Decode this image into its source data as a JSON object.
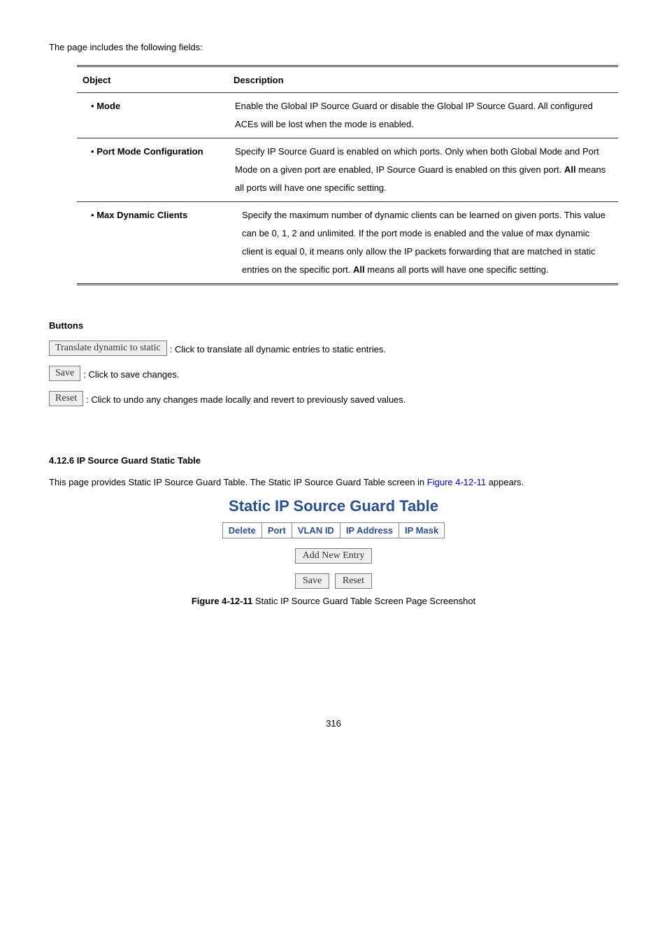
{
  "intro": "The page includes the following fields:",
  "table": {
    "headers": [
      "Object",
      "Description"
    ],
    "rows": [
      {
        "object": "Mode",
        "desc_parts": {
          "a": "Enable the Global IP Source Guard or disable the Global IP Source Guard. All configured ACEs will be lost when the mode is enabled."
        }
      },
      {
        "object": "Port Mode Configuration",
        "desc_parts": {
          "a": "Specify IP Source Guard is enabled on which ports. Only when both Global Mode and Port Mode on a given port are enabled, IP Source Guard is enabled on this given port.",
          "bold": "All",
          "b": "means all ports will have one specific setting."
        }
      },
      {
        "object": "Max Dynamic Clients",
        "desc_parts": {
          "a": "Specify the maximum number of dynamic clients can be learned on given ports. This value can be 0, 1, 2 and unlimited. If the port mode is enabled and the value of max dynamic client is equal 0, it means only allow the IP packets forwarding that are matched in static entries on the specific port.",
          "bold": "All",
          "b": "means all ports will have one specific setting."
        }
      }
    ]
  },
  "buttons_heading": "Buttons",
  "buttons": {
    "translate": {
      "label": "Translate dynamic to static",
      "text": " : Click to translate all dynamic entries to static entries."
    },
    "save": {
      "label": "Save",
      "text": ": Click to save changes."
    },
    "reset": {
      "label": "Reset",
      "text": ": Click to undo any changes made locally and revert to previously saved values."
    }
  },
  "section_heading": "4.12.6 IP Source Guard Static Table",
  "section_text_a": "This page provides Static IP Source Guard Table. The Static IP Source Guard Table screen in ",
  "section_link": "Figure 4-12-11",
  "section_text_b": " appears.",
  "static_title": "Static IP Source Guard Table",
  "static_headers": [
    "Delete",
    "Port",
    "VLAN ID",
    "IP Address",
    "IP Mask"
  ],
  "ui_buttons": {
    "add": "Add New Entry",
    "save": "Save",
    "reset": "Reset"
  },
  "caption_a": "Figure 4-12-11",
  "caption_b": " Static IP Source Guard Table Screen Page Screenshot",
  "page_num": "316"
}
